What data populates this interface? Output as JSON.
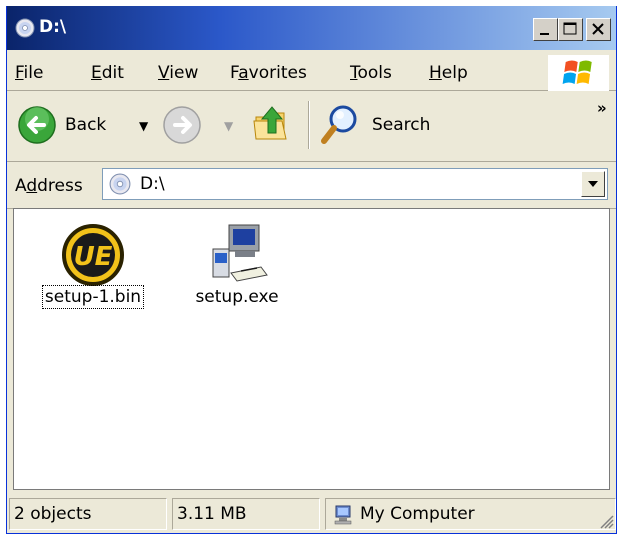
{
  "window": {
    "title": "D:\\",
    "caption_buttons": {
      "minimize": "minimize",
      "maximize": "maximize",
      "close": "close"
    }
  },
  "menu": {
    "items": [
      {
        "label": "File",
        "underline": "F",
        "rest": "ile"
      },
      {
        "label": "Edit",
        "underline": "E",
        "rest": "dit"
      },
      {
        "label": "View",
        "underline": "V",
        "rest": "iew"
      },
      {
        "label": "Favorites",
        "pre": "F",
        "underline": "a",
        "rest": "vorites"
      },
      {
        "label": "Tools",
        "underline": "T",
        "rest": "ools"
      },
      {
        "label": "Help",
        "underline": "H",
        "rest": "elp"
      }
    ]
  },
  "toolbar": {
    "back_label": "Back",
    "search_label": "Search",
    "more": "»"
  },
  "address": {
    "label": "Address",
    "value": "D:\\"
  },
  "files": [
    {
      "name": "setup-1.bin",
      "icon": "ultraedit-icon",
      "focused": true
    },
    {
      "name": "setup.exe",
      "icon": "installer-computer-icon",
      "focused": false
    }
  ],
  "status": {
    "objects": "2 objects",
    "size": "3.11 MB",
    "zone": "My Computer"
  },
  "colors": {
    "title_gradient_start": "#0a246a",
    "title_gradient_end": "#a6caf0",
    "chrome": "#ece9d8"
  }
}
